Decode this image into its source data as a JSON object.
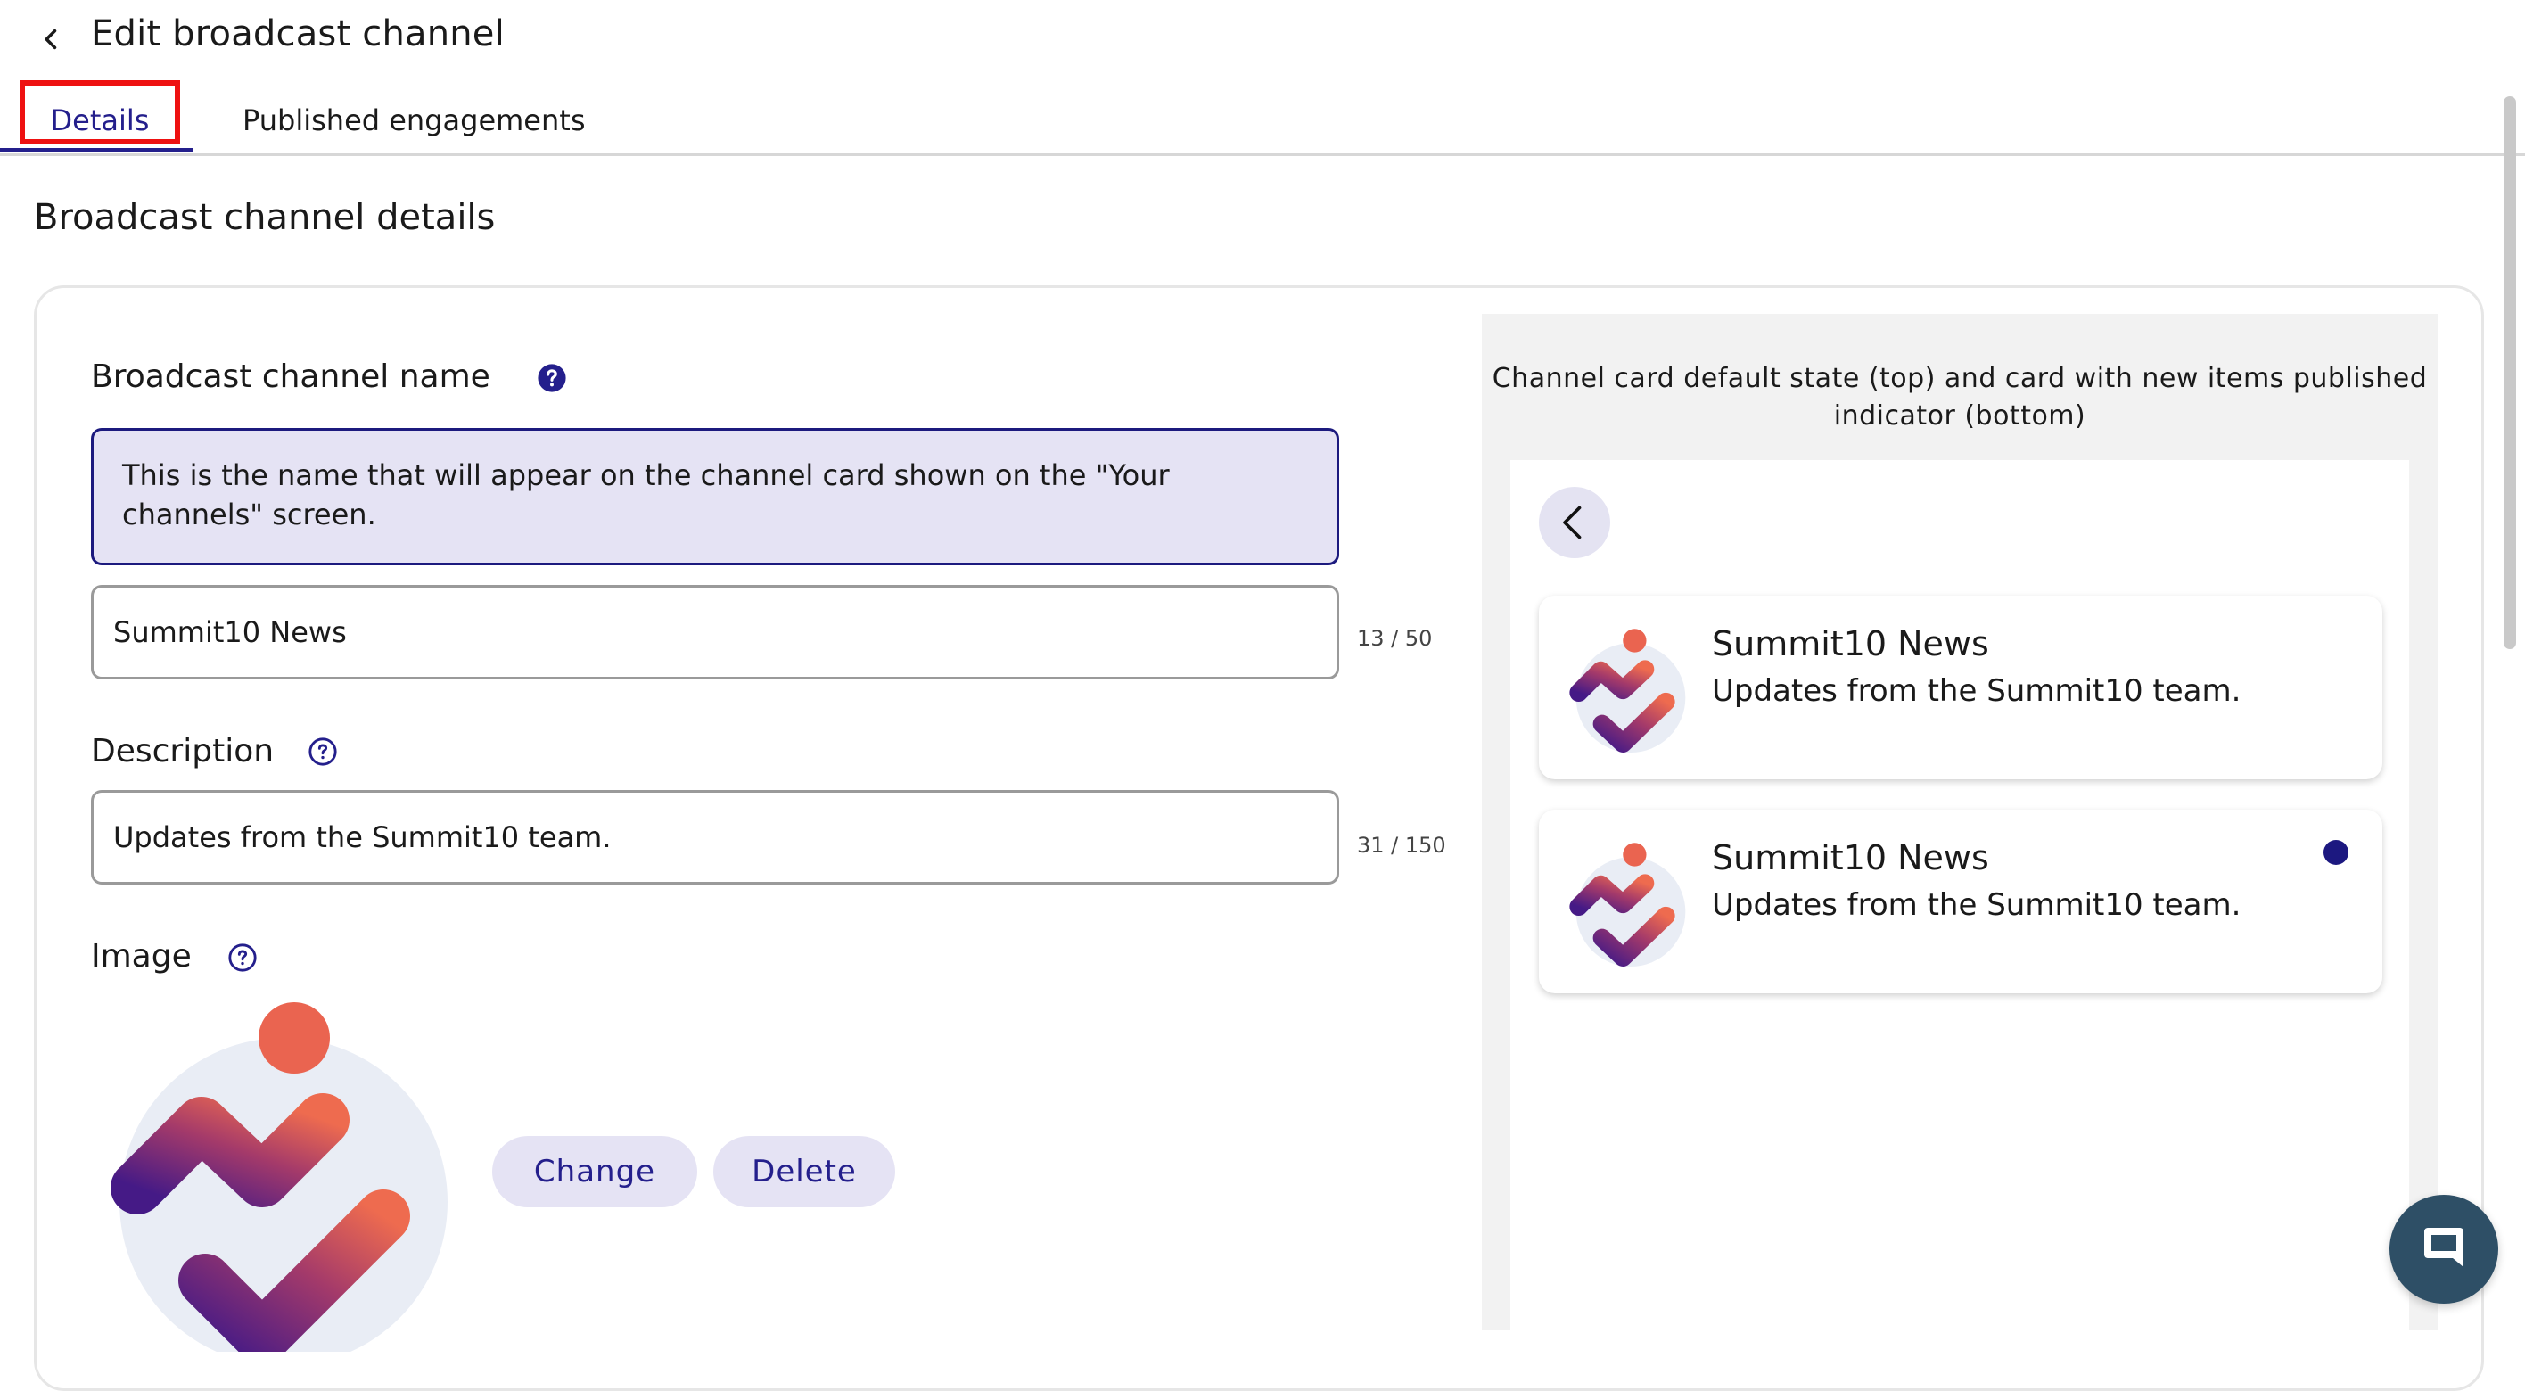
{
  "header": {
    "title": "Edit broadcast channel",
    "back_icon": "chevron-left-icon"
  },
  "tabs": [
    {
      "label": "Details",
      "active": true
    },
    {
      "label": "Published engagements",
      "active": false
    }
  ],
  "section": {
    "title": "Broadcast channel details"
  },
  "form": {
    "name": {
      "label": "Broadcast channel name",
      "help_icon": "question-circle-filled-icon",
      "info_text": "This is the name that will appear on the channel card shown on the \"Your channels\" screen.",
      "value": "Summit10 News",
      "counter": "13 / 50"
    },
    "description": {
      "label": "Description",
      "help_icon": "question-circle-outline-icon",
      "value": "Updates from the Summit10 team.",
      "counter": "31 / 150"
    },
    "image": {
      "label": "Image",
      "help_icon": "question-circle-outline-icon",
      "change_label": "Change",
      "delete_label": "Delete"
    }
  },
  "preview": {
    "caption": "Channel card default state (top) and card with new items published indicator (bottom)",
    "back_icon": "chevron-left-icon",
    "cards": [
      {
        "name": "Summit10 News",
        "description": "Updates from the Summit10 team.",
        "new_indicator": false
      },
      {
        "name": "Summit10 News",
        "description": "Updates from the Summit10 team.",
        "new_indicator": true
      }
    ]
  },
  "colors": {
    "accent": "#241f8c",
    "highlight_box": "#ee1111",
    "info_bg": "#e5e3f4",
    "logo_coral": "#ea6450",
    "logo_purple": "#4a1d85",
    "chat_bg": "#2e4f66"
  },
  "chat_widget_icon": "chat-bubble-icon"
}
